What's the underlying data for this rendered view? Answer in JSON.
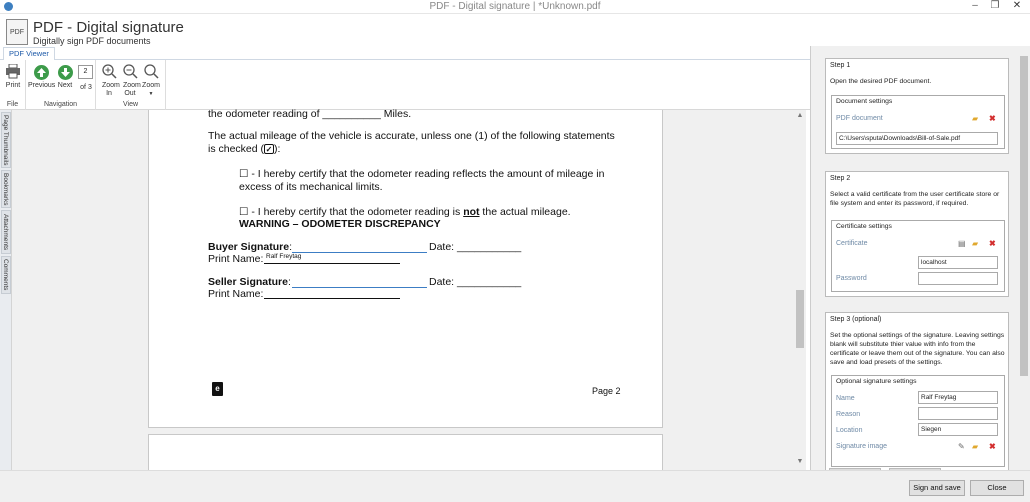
{
  "window": {
    "title": "PDF - Digital signature | *Unknown.pdf"
  },
  "header": {
    "title": "PDF - Digital signature",
    "subtitle": "Digitally sign PDF documents",
    "icon": "pdf-document-icon",
    "icon_text": "PDF"
  },
  "ribbon": {
    "tab": "PDF Viewer",
    "groups": {
      "file": "File",
      "navigation": "Navigation",
      "view": "View"
    },
    "print_label": "Print",
    "previous_label": "Previous",
    "next_label": "Next",
    "page_value": "2",
    "page_total": "of 3",
    "zoom_in_label": "Zoom In",
    "zoom_out_label": "Zoom Out",
    "zoom_label": "Zoom"
  },
  "side_tabs": [
    "Page Thumbnails",
    "Bookmarks",
    "Attachments",
    "Comments"
  ],
  "document": {
    "line1": "the odometer reading of __________ Miles.",
    "line2": "The actual mileage of the vehicle is accurate, unless one (1) of the following statements",
    "line3": "is checked (",
    "line3_end": "):",
    "check1a": "☐ - I hereby certify that the odometer reading reflects the amount of mileage in",
    "check1b": "excess of its mechanical limits.",
    "check2_pre": "☐ - I hereby certify that the odometer reading is ",
    "check2_not": "not",
    "check2_post": " the actual mileage.",
    "warning": "WARNING – ODOMETER DISCREPANCY",
    "buyer_sig": "Buyer Signature",
    "seller_sig": "Seller Signature",
    "colon": ":",
    "date_label": "Date: ___________",
    "print_name": "Print Name:",
    "buyer_print_name_value": "Ralf Freytag",
    "page_number": "Page 2"
  },
  "panel": {
    "step1": {
      "title": "Step 1",
      "desc": "Open the desired PDF document.",
      "section": "Document settings",
      "field_label": "PDF document",
      "path": "C:\\Users\\sputa\\Downloads\\Bill-of-Sale.pdf"
    },
    "step2": {
      "title": "Step 2",
      "desc": "Select a valid certificate from the user certificate store or file system and enter its password, if required.",
      "section": "Certificate settings",
      "cert_label": "Certificate",
      "cert_value": "localhost",
      "password_label": "Password",
      "password_value": ""
    },
    "step3": {
      "title": "Step 3 (optional)",
      "desc": "Set the optional settings of the signature. Leaving settings blank will substitute thier value with info from the certificate or leave them out of the signature. You can also save and load presets of the settings.",
      "section": "Optional signature settings",
      "name_label": "Name",
      "name_value": "Ralf Freytag",
      "reason_label": "Reason",
      "reason_value": "",
      "location_label": "Location",
      "location_value": "Siegen",
      "image_label": "Signature image"
    }
  },
  "footer": {
    "sign_and_save": "Sign and save",
    "close": "Close"
  }
}
